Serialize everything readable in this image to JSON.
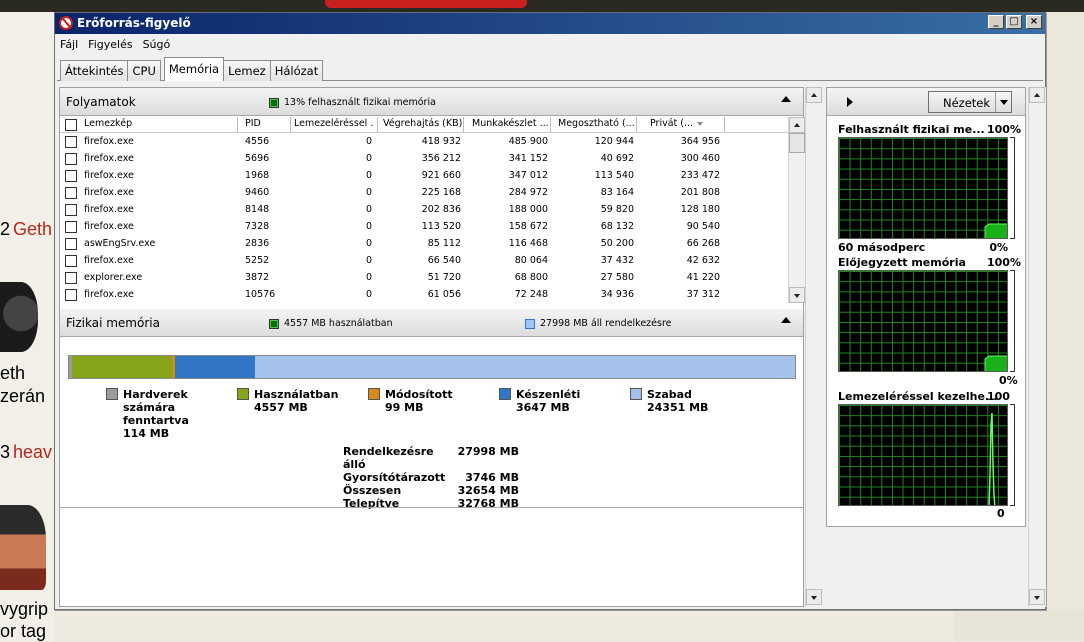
{
  "background": {
    "texts": [
      {
        "id": "num2",
        "text": "2"
      },
      {
        "id": "geth_red",
        "text": "Geth"
      },
      {
        "id": "eth",
        "text": "eth"
      },
      {
        "id": "zeran",
        "text": "zerán"
      },
      {
        "id": "num3",
        "text": "3"
      },
      {
        "id": "heav",
        "text": "heav"
      },
      {
        "id": "vygrip",
        "text": "vygrip"
      },
      {
        "id": "ortag",
        "text": "or tag"
      }
    ]
  },
  "window": {
    "title": "Erőforrás-figyelő",
    "controls": {
      "minimize": "_",
      "maximize": "□",
      "close": "×"
    }
  },
  "menu": [
    "Fájl",
    "Figyelés",
    "Súgó"
  ],
  "tabs": [
    "Áttekintés",
    "CPU",
    "Memória",
    "Lemez",
    "Hálózat"
  ],
  "active_tab": "Memória",
  "processes": {
    "title": "Folyamatok",
    "info": "13% felhasznált fizikai memória",
    "columns": [
      "Lemezkép",
      "PID",
      "Lemezeléréssel ...",
      "Végrehajtás (KB)",
      "Munkakészlet ...",
      "Megosztható (...",
      "Privát (..."
    ],
    "rows": [
      [
        "firefox.exe",
        "4556",
        "0",
        "418 932",
        "485 900",
        "120 944",
        "364 956"
      ],
      [
        "firefox.exe",
        "5696",
        "0",
        "356 212",
        "341 152",
        "40 692",
        "300 460"
      ],
      [
        "firefox.exe",
        "1968",
        "0",
        "921 660",
        "347 012",
        "113 540",
        "233 472"
      ],
      [
        "firefox.exe",
        "9460",
        "0",
        "225 168",
        "284 972",
        "83 164",
        "201 808"
      ],
      [
        "firefox.exe",
        "8148",
        "0",
        "202 836",
        "188 000",
        "59 820",
        "128 180"
      ],
      [
        "firefox.exe",
        "7328",
        "0",
        "113 520",
        "158 672",
        "68 132",
        "90 540"
      ],
      [
        "aswEngSrv.exe",
        "2836",
        "0",
        "85 112",
        "116 468",
        "50 200",
        "66 268"
      ],
      [
        "firefox.exe",
        "5252",
        "0",
        "66 540",
        "80 064",
        "37 432",
        "42 632"
      ],
      [
        "explorer.exe",
        "3872",
        "0",
        "51 720",
        "68 800",
        "27 580",
        "41 220"
      ],
      [
        "firefox.exe",
        "10576",
        "0",
        "61 056",
        "72 248",
        "34 936",
        "37 312"
      ]
    ]
  },
  "physical_memory": {
    "title": "Fizikai memória",
    "in_use_info": "4557 MB használatban",
    "available_info": "27998 MB áll rendelkezésre",
    "bar_fractions": {
      "hardware": 0.0035,
      "in_use": 0.139,
      "modified": 0.003,
      "standby": 0.111,
      "free": 0.7435
    },
    "legend": [
      {
        "label": "Hardverek\nszámára\nfenntartva",
        "value": "114 MB",
        "color": "#9c9c9c"
      },
      {
        "label": "Használatban",
        "value": "4557 MB",
        "color": "#86a51b"
      },
      {
        "label": "Módosított",
        "value": "99 MB",
        "color": "#d98a16"
      },
      {
        "label": "Készenléti",
        "value": "3647 MB",
        "color": "#3276c8"
      },
      {
        "label": "Szabad",
        "value": "24351 MB",
        "color": "#a5c3ea"
      }
    ],
    "stats": [
      {
        "label": "Rendelkezésre álló",
        "value": "27998 MB"
      },
      {
        "label": "Gyorsítótárazott",
        "value": "3746 MB"
      },
      {
        "label": "Összesen",
        "value": "32654 MB"
      },
      {
        "label": "Telepítve",
        "value": "32768 MB"
      }
    ]
  },
  "graphs": {
    "views_label": "Nézetek",
    "items": [
      {
        "title": "Felhasznált fizikai me...",
        "max": "100%",
        "min": "0%",
        "footer": "60 másodperc"
      },
      {
        "title": "Előjegyzett memória",
        "max": "100%",
        "min": "0%"
      },
      {
        "title": "Lemezeléréssel kezelhe...",
        "max": "100",
        "min": "0"
      }
    ]
  }
}
